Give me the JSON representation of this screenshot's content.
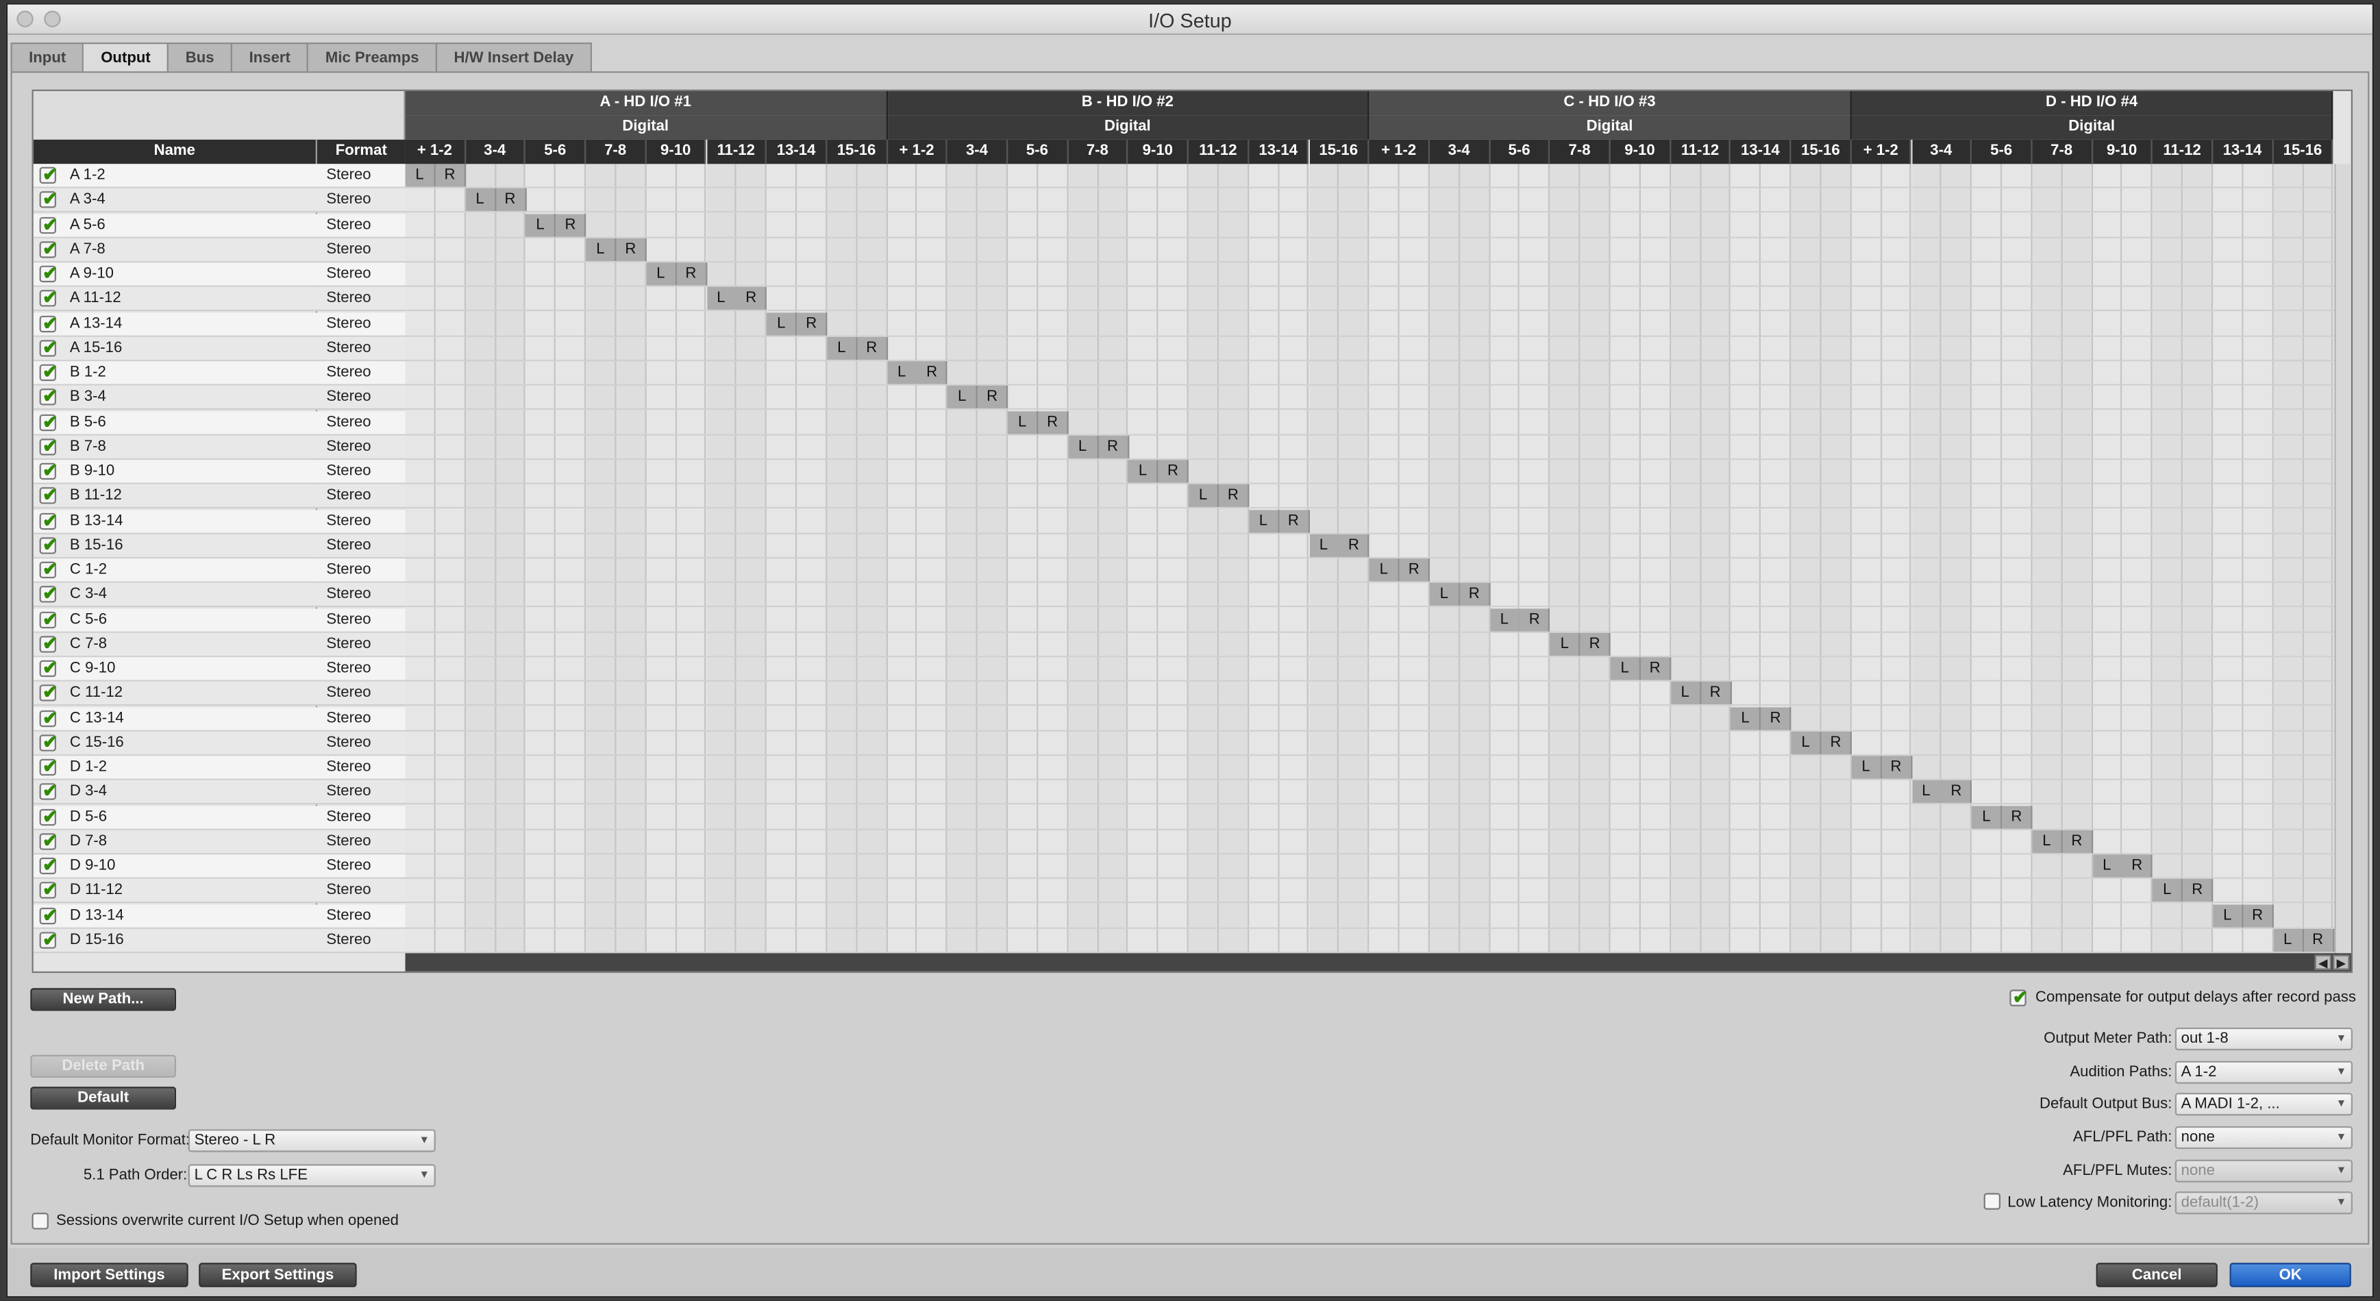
{
  "window": {
    "title": "I/O Setup"
  },
  "tabs": [
    {
      "label": "Input",
      "active": false
    },
    {
      "label": "Output",
      "active": true
    },
    {
      "label": "Bus",
      "active": false
    },
    {
      "label": "Insert",
      "active": false
    },
    {
      "label": "Mic Preamps",
      "active": false
    },
    {
      "label": "H/W Insert Delay",
      "active": false
    }
  ],
  "grid": {
    "name_header": "Name",
    "format_header": "Format",
    "interfaces": [
      {
        "name": "A - HD I/O #1",
        "format": "Digital"
      },
      {
        "name": "B - HD I/O #2",
        "format": "Digital"
      },
      {
        "name": "C - HD I/O #3",
        "format": "Digital"
      },
      {
        "name": "D - HD I/O #4",
        "format": "Digital"
      }
    ],
    "channel_pairs": [
      "+ 1-2",
      "3-4",
      "5-6",
      "7-8",
      "9-10",
      "11-12",
      "13-14",
      "15-16"
    ],
    "assign_labels": [
      "L",
      "R"
    ],
    "paths": [
      {
        "name": "A 1-2",
        "format": "Stereo",
        "enabled": true
      },
      {
        "name": "A 3-4",
        "format": "Stereo",
        "enabled": true
      },
      {
        "name": "A 5-6",
        "format": "Stereo",
        "enabled": true
      },
      {
        "name": "A 7-8",
        "format": "Stereo",
        "enabled": true
      },
      {
        "name": "A 9-10",
        "format": "Stereo",
        "enabled": true
      },
      {
        "name": "A 11-12",
        "format": "Stereo",
        "enabled": true
      },
      {
        "name": "A 13-14",
        "format": "Stereo",
        "enabled": true
      },
      {
        "name": "A 15-16",
        "format": "Stereo",
        "enabled": true
      },
      {
        "name": "B 1-2",
        "format": "Stereo",
        "enabled": true
      },
      {
        "name": "B 3-4",
        "format": "Stereo",
        "enabled": true
      },
      {
        "name": "B 5-6",
        "format": "Stereo",
        "enabled": true
      },
      {
        "name": "B 7-8",
        "format": "Stereo",
        "enabled": true
      },
      {
        "name": "B 9-10",
        "format": "Stereo",
        "enabled": true
      },
      {
        "name": "B 11-12",
        "format": "Stereo",
        "enabled": true
      },
      {
        "name": "B 13-14",
        "format": "Stereo",
        "enabled": true
      },
      {
        "name": "B 15-16",
        "format": "Stereo",
        "enabled": true
      },
      {
        "name": "C 1-2",
        "format": "Stereo",
        "enabled": true
      },
      {
        "name": "C 3-4",
        "format": "Stereo",
        "enabled": true
      },
      {
        "name": "C 5-6",
        "format": "Stereo",
        "enabled": true
      },
      {
        "name": "C 7-8",
        "format": "Stereo",
        "enabled": true
      },
      {
        "name": "C 9-10",
        "format": "Stereo",
        "enabled": true
      },
      {
        "name": "C 11-12",
        "format": "Stereo",
        "enabled": true
      },
      {
        "name": "C 13-14",
        "format": "Stereo",
        "enabled": true
      },
      {
        "name": "C 15-16",
        "format": "Stereo",
        "enabled": true
      },
      {
        "name": "D 1-2",
        "format": "Stereo",
        "enabled": true
      },
      {
        "name": "D 3-4",
        "format": "Stereo",
        "enabled": true
      },
      {
        "name": "D 5-6",
        "format": "Stereo",
        "enabled": true
      },
      {
        "name": "D 7-8",
        "format": "Stereo",
        "enabled": true
      },
      {
        "name": "D 9-10",
        "format": "Stereo",
        "enabled": true
      },
      {
        "name": "D 11-12",
        "format": "Stereo",
        "enabled": true
      },
      {
        "name": "D 13-14",
        "format": "Stereo",
        "enabled": true
      },
      {
        "name": "D 15-16",
        "format": "Stereo",
        "enabled": true
      }
    ]
  },
  "buttons": {
    "new_path": "New Path...",
    "delete_path": "Delete Path",
    "default": "Default",
    "import_settings": "Import Settings",
    "export_settings": "Export Settings",
    "cancel": "Cancel",
    "ok": "OK"
  },
  "left_settings": {
    "monitor_format_label": "Default Monitor Format:",
    "monitor_format_value": "Stereo - L R",
    "path_order_label": "5.1 Path Order:",
    "path_order_value": "L C R Ls Rs LFE",
    "overwrite_label": "Sessions overwrite current I/O Setup when opened",
    "overwrite_checked": false
  },
  "right_settings": {
    "compensate_label": "Compensate for output delays after record pass",
    "compensate_checked": true,
    "output_meter_label": "Output Meter Path:",
    "output_meter_value": "out 1-8",
    "audition_label": "Audition Paths:",
    "audition_value": "A 1-2",
    "default_bus_label": "Default Output Bus:",
    "default_bus_value": "A MADI 1-2, ...",
    "afl_path_label": "AFL/PFL Path:",
    "afl_path_value": "none",
    "afl_mutes_label": "AFL/PFL Mutes:",
    "afl_mutes_value": "none",
    "low_latency_label": "Low Latency Monitoring:",
    "low_latency_value": "default(1-2)",
    "low_latency_checked": false
  },
  "colors": {
    "ok_button": "#1c5fc4",
    "checkmark": "#2e8b00",
    "header_dark": "#2d2d2d"
  }
}
